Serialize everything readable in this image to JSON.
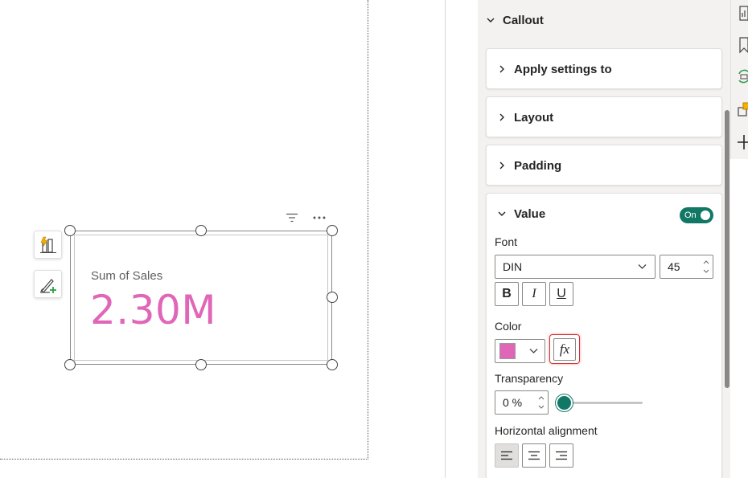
{
  "card": {
    "label": "Sum of Sales",
    "value": "2.30M",
    "value_color": "#e066b8"
  },
  "visual_header_icons": [
    "filter-icon",
    "more-options-icon"
  ],
  "floating_buttons": [
    "build-visual-icon",
    "format-visual-icon"
  ],
  "format_pane": {
    "callout_title": "Callout",
    "sections": {
      "apply_settings_to": "Apply settings to",
      "layout": "Layout",
      "padding": "Padding",
      "value": "Value"
    },
    "value_toggle": "On",
    "font_label": "Font",
    "font_family": "DIN",
    "font_size": "45",
    "bold_label": "B",
    "italic_label": "I",
    "underline_label": "U",
    "color_label": "Color",
    "color_swatch": "#e066b8",
    "fx_label": "fx",
    "transparency_label": "Transparency",
    "transparency_value": "0 %",
    "transparency_percent": 0,
    "horizontal_alignment_label": "Horizontal alignment",
    "alignment_options": [
      "left",
      "center",
      "right"
    ],
    "alignment_selected": "left"
  },
  "colors": {
    "accent_teal": "#117865",
    "highlight_red": "#d13438"
  }
}
